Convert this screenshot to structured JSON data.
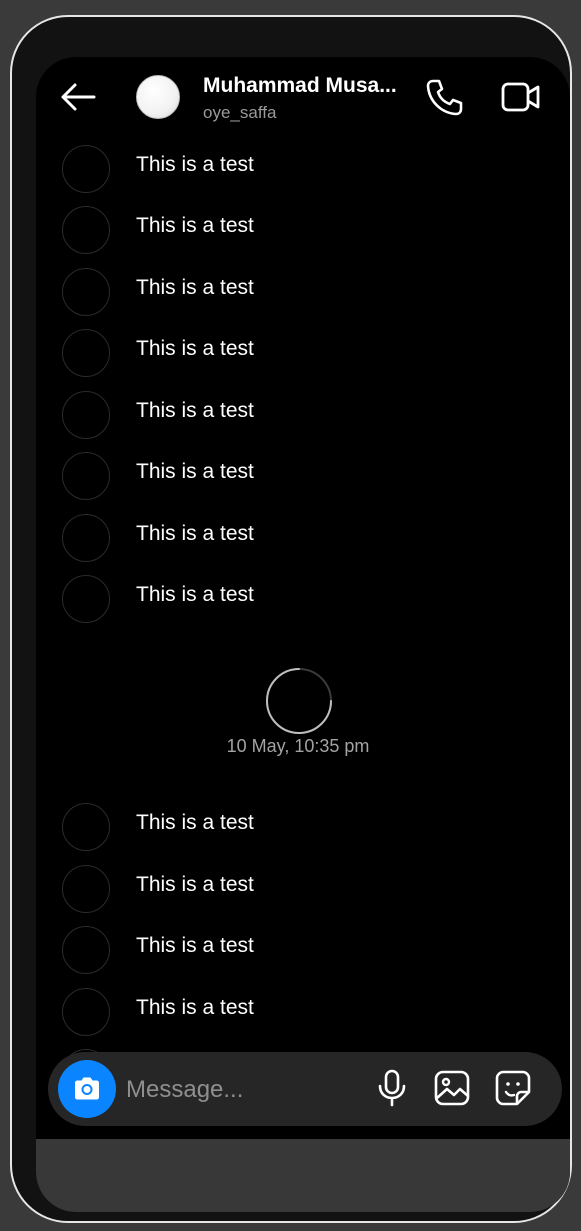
{
  "header": {
    "name": "Muhammad Musa...",
    "username": "oye_saffa"
  },
  "messages_before": [
    {
      "text": "This is a test"
    },
    {
      "text": "This is a test"
    },
    {
      "text": "This is a test"
    },
    {
      "text": "This is a test"
    },
    {
      "text": "This is a test"
    },
    {
      "text": "This is a test"
    },
    {
      "text": "This is a test"
    },
    {
      "text": "This is a test"
    }
  ],
  "timestamp": "10 May, 10:35 pm",
  "messages_after": [
    {
      "text": "This is a test"
    },
    {
      "text": "This is a test"
    },
    {
      "text": "This is a test"
    },
    {
      "text": "This is a test"
    }
  ],
  "composer": {
    "placeholder": "Message..."
  },
  "icons": {
    "back": "arrow-left-icon",
    "call": "phone-icon",
    "video": "video-camera-icon",
    "camera": "camera-icon",
    "mic": "microphone-icon",
    "gallery": "image-icon",
    "sticker": "sticker-icon"
  },
  "colors": {
    "accent": "#0a84ff",
    "background": "#000000",
    "composer": "#262626"
  }
}
